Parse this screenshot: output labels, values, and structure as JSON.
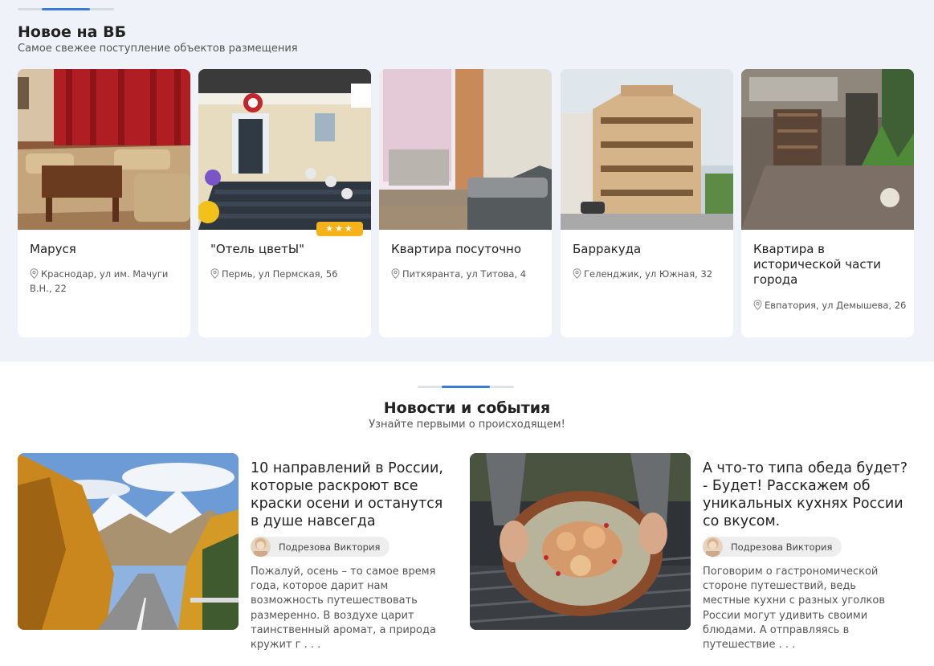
{
  "new_section": {
    "title": "Новое на ВБ",
    "subtitle": "Самое свежее поступление объектов размещения",
    "cards": [
      {
        "name": "Маруся",
        "address": "Краснодар, ул им. Мачуги В.Н., 22",
        "photo": "living-room-photo"
      },
      {
        "name": "\"Отель цветЫ\"",
        "address": "Пермь, ул Пермская, 56",
        "photo": "hotel-entrance-photo",
        "stars": 3
      },
      {
        "name": "Квартира посуточно",
        "address": "Питкяранта, ул Титова, 4",
        "photo": "apartment-room-photo"
      },
      {
        "name": "Барракуда",
        "address": "Геленджик, ул Южная, 32",
        "photo": "hotel-building-photo"
      },
      {
        "name": "Квартира в исторической части города",
        "address": "Евпатория, ул Демышева, 26",
        "photo": "courtyard-photo"
      }
    ]
  },
  "news_section": {
    "title": "Новости и события",
    "subtitle": "Узнайте первыми о происходящем!",
    "articles": [
      {
        "title": "10 направлений в России, которые раскроют все краски осени и останутся в душе навсегда",
        "author": "Подрезова Виктория",
        "excerpt": "Пожалуй, осень – то самое время года, которое дарит нам возможность путешествовать размеренно. В воздухе царит таинственный аромат, а природа кружит г . . .",
        "photo": "autumn-road-photo"
      },
      {
        "title": "А что-то типа обеда будет? - Будет! Расскажем об уникальных кухнях России со вкусом.",
        "author": "Подрезова Виктория",
        "excerpt": "Поговорим о гастрономической стороне путешествий, ведь местные кухни с разных уголков России могут удивить своими блюдами. А отправляясь в путешествие . . .",
        "photo": "soup-bowl-photo"
      }
    ]
  },
  "colors": {
    "accent": "#3a7bd5",
    "section_bg": "#eff2f8",
    "star_badge": "#f5b21a"
  }
}
